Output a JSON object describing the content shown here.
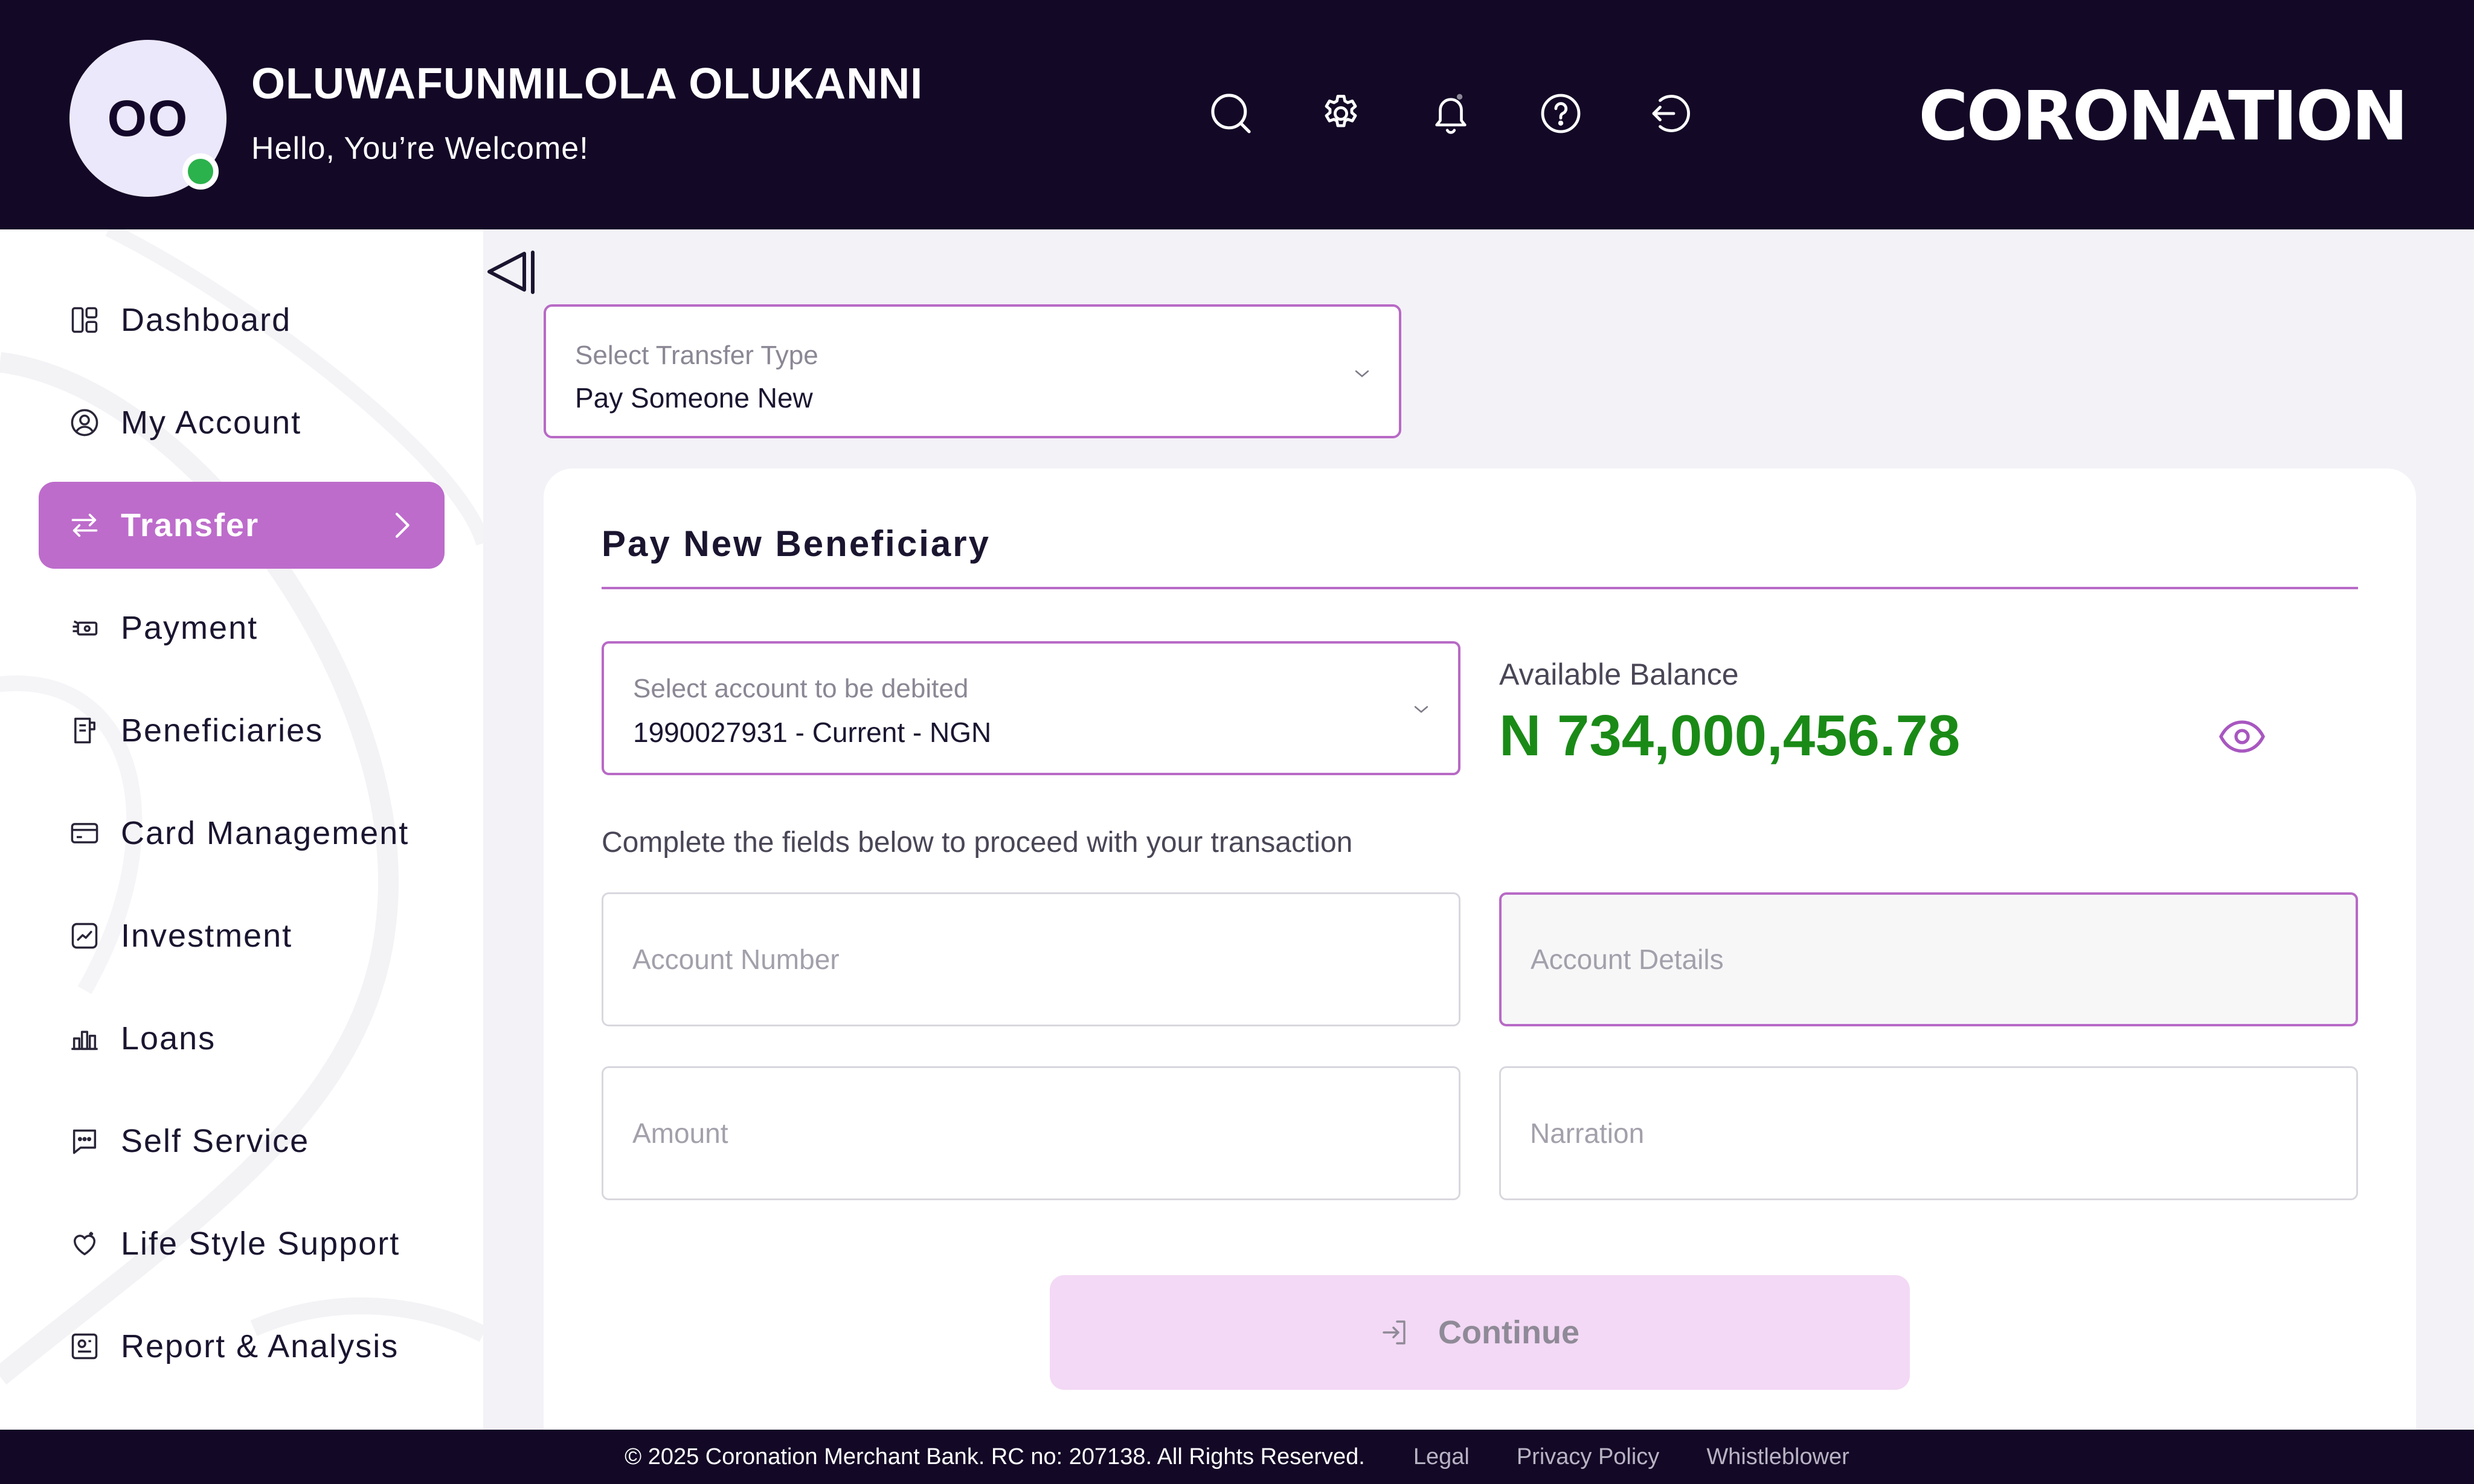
{
  "header": {
    "avatar_initials": "OO",
    "user_name": "OLUWAFUNMILOLA OLUKANNI",
    "greeting": "Hello, You’re Welcome!",
    "logo_text": "CORONATION",
    "icons": [
      "search-icon",
      "gear-icon",
      "bell-icon",
      "help-icon",
      "logout-icon"
    ],
    "colors": {
      "background": "#130826",
      "online_status": "#2bb24c"
    }
  },
  "sidebar": {
    "items": [
      {
        "label": "Dashboard",
        "icon": "dashboard-icon"
      },
      {
        "label": "My Account",
        "icon": "user-circle-icon"
      },
      {
        "label": "Transfer",
        "icon": "transfer-arrows-icon",
        "active": true
      },
      {
        "label": "Payment",
        "icon": "payment-icon"
      },
      {
        "label": "Beneficiaries",
        "icon": "beneficiaries-icon"
      },
      {
        "label": "Card Management",
        "icon": "card-icon"
      },
      {
        "label": "Investment",
        "icon": "investment-chart-icon"
      },
      {
        "label": "Loans",
        "icon": "loans-bar-icon"
      },
      {
        "label": "Self Service",
        "icon": "chat-icon"
      },
      {
        "label": "Life Style Support",
        "icon": "heart-icon"
      },
      {
        "label": "Report & Analysis",
        "icon": "report-icon"
      }
    ],
    "colors": {
      "active_background": "#bd6ccb"
    }
  },
  "transfer_type": {
    "label": "Select Transfer Type",
    "value": "Pay Someone New"
  },
  "card": {
    "title": "Pay New Beneficiary",
    "debit_account": {
      "label": "Select account to be debited",
      "value": "1990027931 - Current - NGN"
    },
    "balance": {
      "label": "Available Balance",
      "value": "N 734,000,456.78",
      "color": "#1a8a17"
    },
    "instruction": "Complete the fields below to proceed with your transaction",
    "fields": {
      "account_number_placeholder": "Account Number",
      "account_details_placeholder": "Account Details",
      "amount_placeholder": "Amount",
      "narration_placeholder": "Narration"
    },
    "continue_label": "Continue"
  },
  "footer": {
    "copyright": "© 2025 Coronation Merchant Bank. RC no: 207138. All Rights Reserved.",
    "links": [
      "Legal",
      "Privacy Policy",
      "Whistleblower"
    ]
  }
}
